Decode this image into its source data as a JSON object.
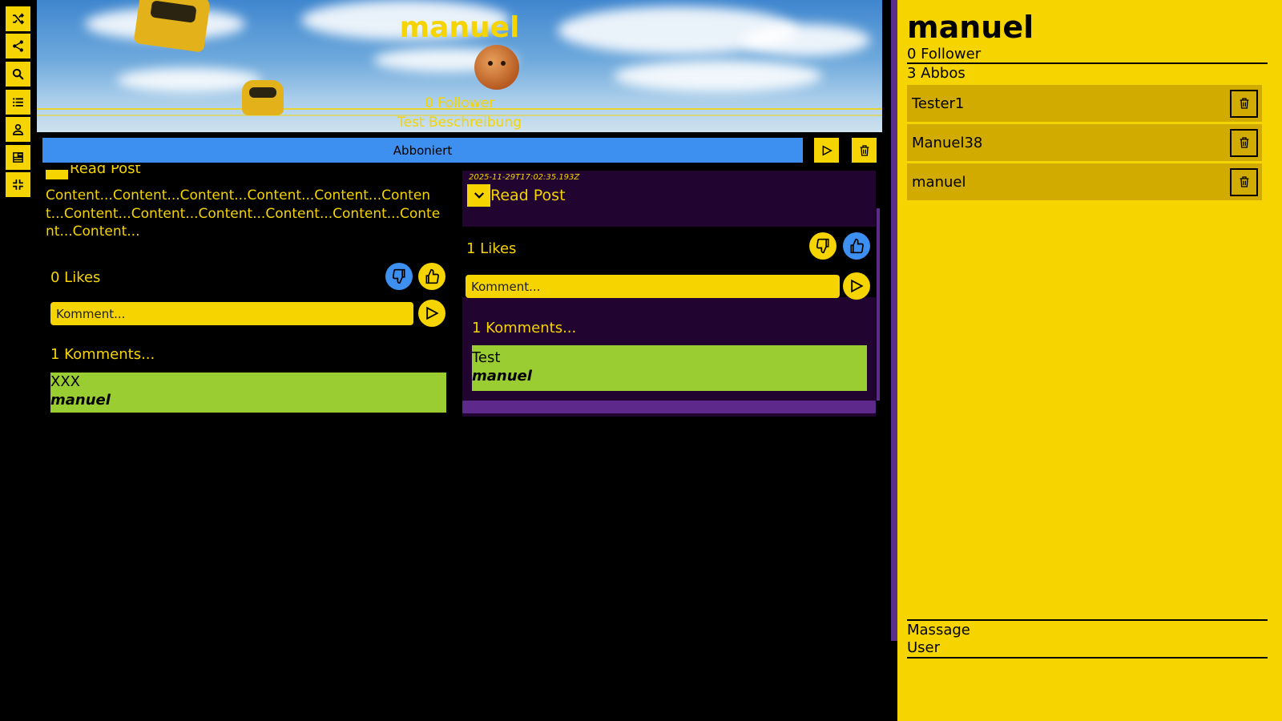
{
  "toolbar": {
    "icons": [
      "shuffle-icon",
      "share-icon",
      "search-icon",
      "list-icon",
      "profile-icon",
      "feed-icon",
      "collapse-icon"
    ]
  },
  "banner": {
    "name": "manuel",
    "followers": "0 Follower",
    "description": "Test Beschreibung"
  },
  "follow_bar": {
    "label": "Abboniert"
  },
  "post_left": {
    "read_label": "Read Post",
    "content": "Content...Content...Content...Content...Content...Content...Content...Content...Content...Content...Content...Content...Content...",
    "likes": "0 Likes",
    "comment_placeholder": "Komment...",
    "comments_count": "1 Komments...",
    "comments": [
      {
        "text": "XXX",
        "author": "manuel"
      }
    ]
  },
  "post_right": {
    "date": "2025-11-29T17:02:35.193Z",
    "read_label": "Read Post",
    "likes": "1 Likes",
    "comment_placeholder": "Komment...",
    "comments_count": "1 Komments...",
    "comments": [
      {
        "text": "Test",
        "author": "manuel"
      }
    ]
  },
  "sidebar": {
    "name": "manuel",
    "followers": "0 Follower",
    "abbos": "3 Abbos",
    "abbo_list": [
      "Tester1",
      "Manuel38",
      "manuel"
    ],
    "footer_line1": "Massage",
    "footer_line2": "User"
  },
  "colors": {
    "accent_yellow": "#f5d400",
    "accent_blue": "#3d8ff0",
    "comment_green": "#9acd32",
    "purple": "#5a2f8a"
  }
}
